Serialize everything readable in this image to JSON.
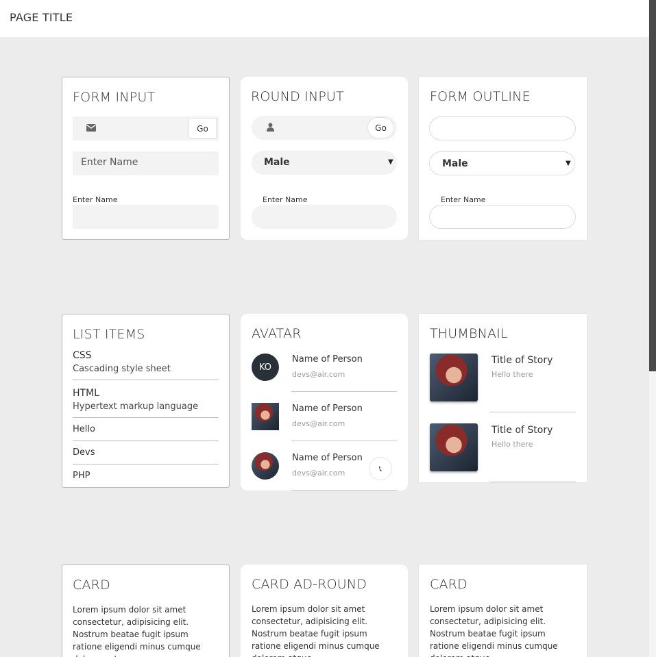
{
  "page": {
    "title": "PAGE TITLE"
  },
  "form_input": {
    "title": "FORM INPUT",
    "go_label": "Go",
    "name_placeholder": "Enter Name",
    "label": "Enter Name"
  },
  "round_input": {
    "title": "ROUND INPUT",
    "go_label": "Go",
    "select_value": "Male",
    "label": "Enter Name"
  },
  "form_outline": {
    "title": "FORM OUTLINE",
    "select_value": "Male",
    "label": "Enter Name"
  },
  "list_items": {
    "title": "LIST ITEMS",
    "items": [
      {
        "title": "CSS",
        "subtitle": "Cascading style sheet"
      },
      {
        "title": "HTML",
        "subtitle": "Hypertext markup language"
      },
      {
        "title": "Hello"
      },
      {
        "title": "Devs"
      },
      {
        "title": "PHP"
      }
    ]
  },
  "avatar": {
    "title": "AVATAR",
    "items": [
      {
        "initials": "KO",
        "name": "Name of Person",
        "email": "devs@air.com"
      },
      {
        "name": "Name of Person",
        "email": "devs@air.com"
      },
      {
        "name": "Name of Person",
        "email": "devs@air.com"
      }
    ]
  },
  "thumbnail": {
    "title": "THUMBNAIL",
    "items": [
      {
        "title": "Title of Story",
        "subtitle": "Hello there"
      },
      {
        "title": "Title of Story",
        "subtitle": "Hello there"
      }
    ]
  },
  "cards": [
    {
      "title": "CARD",
      "body": "Lorem ipsum dolor sit amet consectetur, adipisicing elit. Nostrum beatae fugit ipsum ratione eligendi minus cumque dolorem atque"
    },
    {
      "title": "CARD AD-ROUND",
      "body": "Lorem ipsum dolor sit amet consectetur, adipisicing elit. Nostrum beatae fugit ipsum ratione eligendi minus cumque dolorem atque"
    },
    {
      "title": "CARD",
      "body": "Lorem ipsum dolor sit amet consectetur, adipisicing elit. Nostrum beatae fugit ipsum ratione eligendi minus cumque dolorem atque"
    }
  ],
  "icons": {
    "envelope": "envelope-icon",
    "user": "user-icon",
    "phone": "phone-icon",
    "caret": "caret-down-icon"
  }
}
